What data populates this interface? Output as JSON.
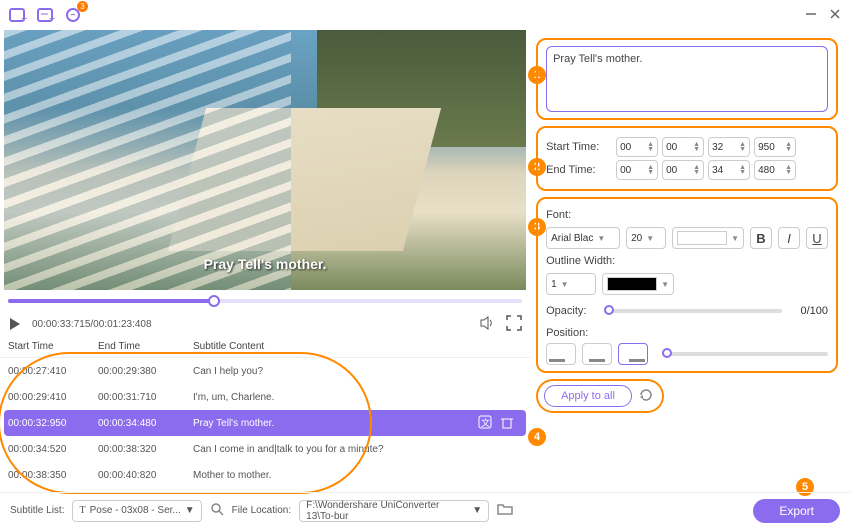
{
  "toolbar": {
    "badge": "3"
  },
  "preview": {
    "subtitle_overlay": "Pray Tell's mother."
  },
  "playback": {
    "time": "00:00:33:715/00:01:23:408"
  },
  "table": {
    "headers": {
      "start": "Start Time",
      "end": "End Time",
      "content": "Subtitle Content"
    },
    "rows": [
      {
        "start": "00:00:27:410",
        "end": "00:00:29:380",
        "content": "Can I help you?"
      },
      {
        "start": "00:00:29:410",
        "end": "00:00:31:710",
        "content": "I'm, um, Charlene."
      },
      {
        "start": "00:00:32:950",
        "end": "00:00:34:480",
        "content": "Pray Tell's mother."
      },
      {
        "start": "00:00:34:520",
        "end": "00:00:38:320",
        "content": "Can I come in and|talk to you for a minute?"
      },
      {
        "start": "00:00:38:350",
        "end": "00:00:40:820",
        "content": "Mother to mother."
      }
    ]
  },
  "editor": {
    "text": "Pray Tell's mother.",
    "start_label": "Start Time:",
    "end_label": "End Time:",
    "start": {
      "h": "00",
      "m": "00",
      "s": "32",
      "ms": "950"
    },
    "end": {
      "h": "00",
      "m": "00",
      "s": "34",
      "ms": "480"
    },
    "font_label": "Font:",
    "font_name": "Arial Blac",
    "font_size": "20",
    "outline_label": "Outline Width:",
    "outline_width": "1",
    "opacity_label": "Opacity:",
    "opacity_value": "0/100",
    "position_label": "Position:",
    "apply_label": "Apply to all"
  },
  "footer": {
    "list_label": "Subtitle List:",
    "list_value": "Pose - 03x08 - Ser...",
    "loc_label": "File Location:",
    "loc_value": "F:\\Wondershare UniConverter 13\\To-bur",
    "export": "Export"
  },
  "markers": {
    "1": "1",
    "2": "2",
    "3": "3",
    "4": "4",
    "5": "5"
  }
}
